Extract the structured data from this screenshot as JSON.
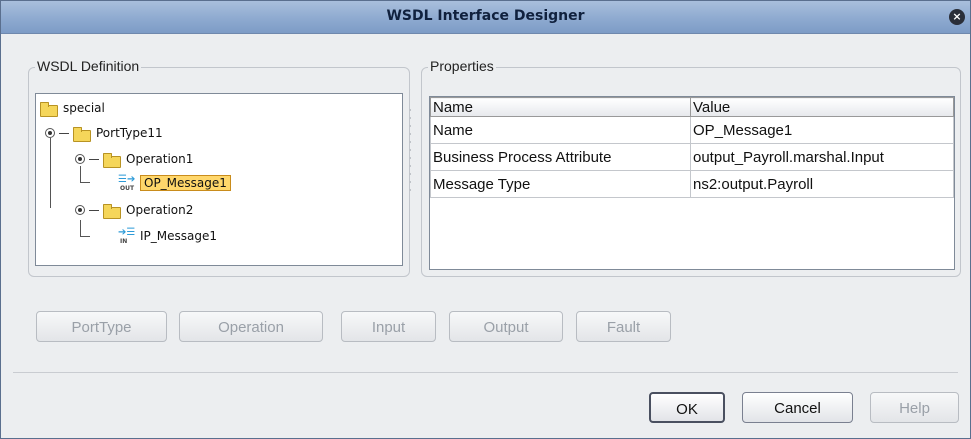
{
  "window": {
    "title": "WSDL Interface Designer",
    "close_glyph": "×"
  },
  "wsdl_panel": {
    "label": "WSDL Definition",
    "tree": {
      "root": "special",
      "porttype": "PortType11",
      "operation1": "Operation1",
      "op_message": "OP_Message1",
      "operation2": "Operation2",
      "ip_message": "IP_Message1"
    },
    "icons": {
      "out_label": "OUT",
      "in_label": "IN"
    }
  },
  "properties_panel": {
    "label": "Properties",
    "columns": [
      "Name",
      "Value"
    ],
    "rows": [
      [
        "Name",
        "OP_Message1"
      ],
      [
        "Business Process Attribute",
        "output_Payroll.marshal.Input"
      ],
      [
        "Message Type",
        "ns2:output.Payroll"
      ]
    ]
  },
  "toolbar": {
    "porttype": "PortType",
    "operation": "Operation",
    "input": "Input",
    "output": "Output",
    "fault": "Fault"
  },
  "footer": {
    "ok": "OK",
    "cancel": "Cancel",
    "help": "Help"
  }
}
